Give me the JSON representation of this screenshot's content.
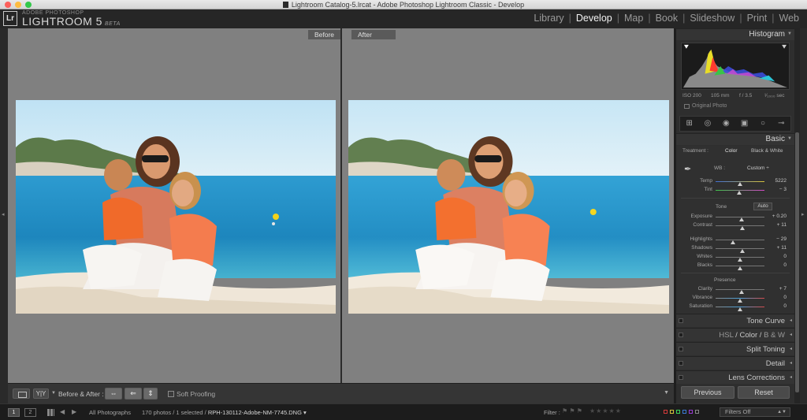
{
  "window": {
    "title": "Lightroom Catalog-5.lrcat - Adobe Photoshop Lightroom Classic - Develop"
  },
  "identity": {
    "badge": "Lr",
    "company": "ADOBE PHOTOSHOP",
    "product": "LIGHTROOM 5",
    "tag": "BETA"
  },
  "modules": [
    "Library",
    "Develop",
    "Map",
    "Book",
    "Slideshow",
    "Print",
    "Web"
  ],
  "modules_active": "Develop",
  "panes": {
    "before_label": "Before",
    "after_label": "After"
  },
  "toolbar": {
    "view_mode": "Y|Y",
    "before_after_label": "Before & After :",
    "swap_1": "⇔",
    "swap_2": "⇐",
    "swap_3": "⇕",
    "soft_proofing": "Soft Proofing"
  },
  "histogram": {
    "title": "Histogram",
    "iso": "ISO 200",
    "focal": "105 mm",
    "aperture": "f / 3.5",
    "shutter": "¹⁄₁₀₀₀ sec",
    "original_photo": "Original Photo"
  },
  "basic": {
    "title": "Basic",
    "treatment_label": "Treatment :",
    "treatment_color": "Color",
    "treatment_bw": "Black & White",
    "wb_label": "WB :",
    "wb_value": "Custom ÷",
    "tone_label": "Tone",
    "auto_label": "Auto",
    "presence_label": "Presence",
    "sliders": [
      {
        "label": "Temp",
        "value": "5222",
        "position": 0.5
      },
      {
        "label": "Tint",
        "value": "− 3",
        "position": 0.48
      },
      {
        "label": "Exposure",
        "value": "+ 0.20",
        "position": 0.53
      },
      {
        "label": "Contrast",
        "value": "+ 11",
        "position": 0.55
      },
      {
        "label": "Highlights",
        "value": "− 29",
        "position": 0.36
      },
      {
        "label": "Shadows",
        "value": "+ 11",
        "position": 0.55
      },
      {
        "label": "Whites",
        "value": "0",
        "position": 0.5
      },
      {
        "label": "Blacks",
        "value": "0",
        "position": 0.5
      },
      {
        "label": "Clarity",
        "value": "+ 7",
        "position": 0.53
      },
      {
        "label": "Vibrance",
        "value": "0",
        "position": 0.5
      },
      {
        "label": "Saturation",
        "value": "0",
        "position": 0.5
      }
    ]
  },
  "panels": {
    "tone_curve": "Tone Curve",
    "hsl": "HSL",
    "color": "Color",
    "bw": "B & W",
    "split_toning": "Split Toning",
    "detail": "Detail",
    "lens_corrections": "Lens Corrections"
  },
  "buttons": {
    "previous": "Previous",
    "reset": "Reset"
  },
  "filmstrip": {
    "screen1": "1",
    "screen2": "2",
    "source": "All Photographs",
    "count": "170 photos / 1 selected /",
    "filename": "RPH-130112-Adobe-NM-7745.DNG ▾",
    "filter_label": "Filter :",
    "filters_off": "Filters Off"
  }
}
